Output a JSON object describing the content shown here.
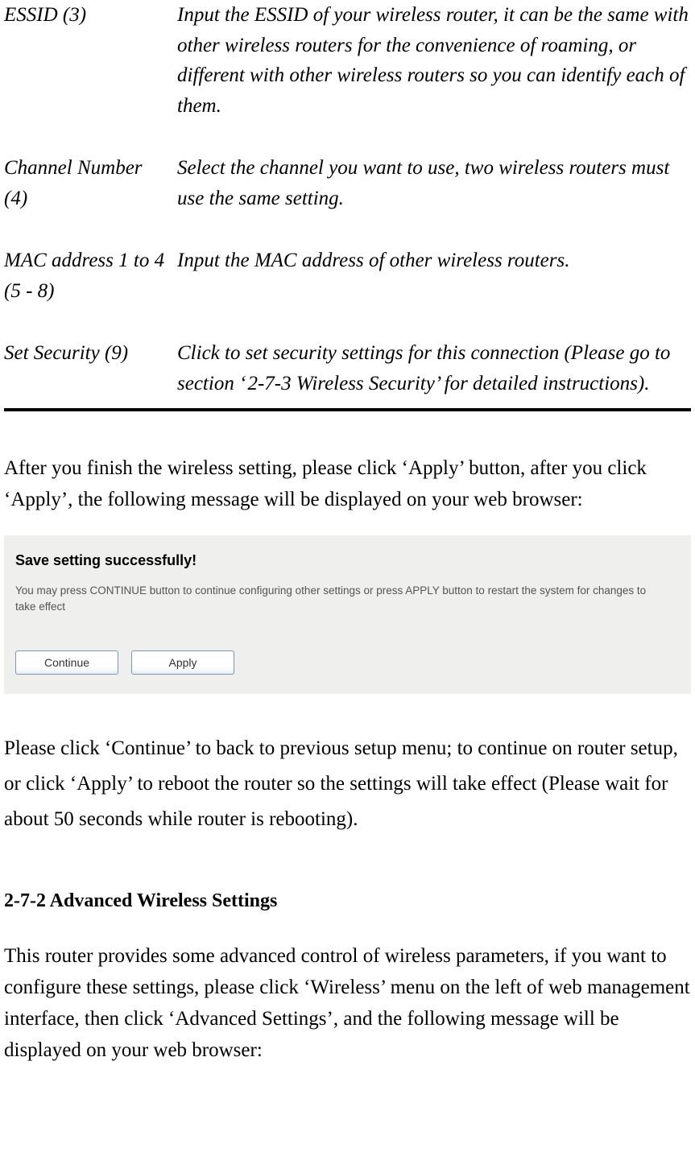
{
  "definitions": [
    {
      "term": "ESSID (3)",
      "desc": "Input the ESSID of your wireless router, it can be the same with other wireless routers for the convenience of roaming, or different with other wireless routers so you can identify each of them."
    },
    {
      "term": "Channel Number (4)",
      "desc": "Select the channel you want to use, two wireless routers must use the same setting."
    },
    {
      "term": "MAC address 1 to 4 (5 - 8)",
      "desc": "Input the MAC address of other wireless routers."
    },
    {
      "term": "Set Security (9)",
      "desc": "Click to set security settings for this connection (Please go to section ‘ 2-7-3 Wireless Security’ for detailed instructions)."
    }
  ],
  "paragraph_after_table": "After you finish the wireless setting, please click ‘Apply’ button, after you click ‘Apply’, the following message will be displayed on your web browser:",
  "screenshot": {
    "title": "Save setting successfully!",
    "subtitle": "You may press CONTINUE button to continue configuring other settings or press APPLY button to restart the system for changes to take effect",
    "continue_label": "Continue",
    "apply_label": "Apply"
  },
  "paragraph_after_screenshot": "Please click ‘Continue’ to back to previous setup menu; to continue on router setup, or click ‘Apply’ to reboot the router so the settings will take effect (Please wait for about 50 seconds while router is rebooting).",
  "section_heading": "2-7-2 Advanced Wireless Settings",
  "section_paragraph": "This router provides some advanced control of wireless parameters, if you want to configure these settings, please click ‘Wireless’ menu on the left of web management interface, then click ‘Advanced Settings’, and the following message will be displayed on your web browser:"
}
